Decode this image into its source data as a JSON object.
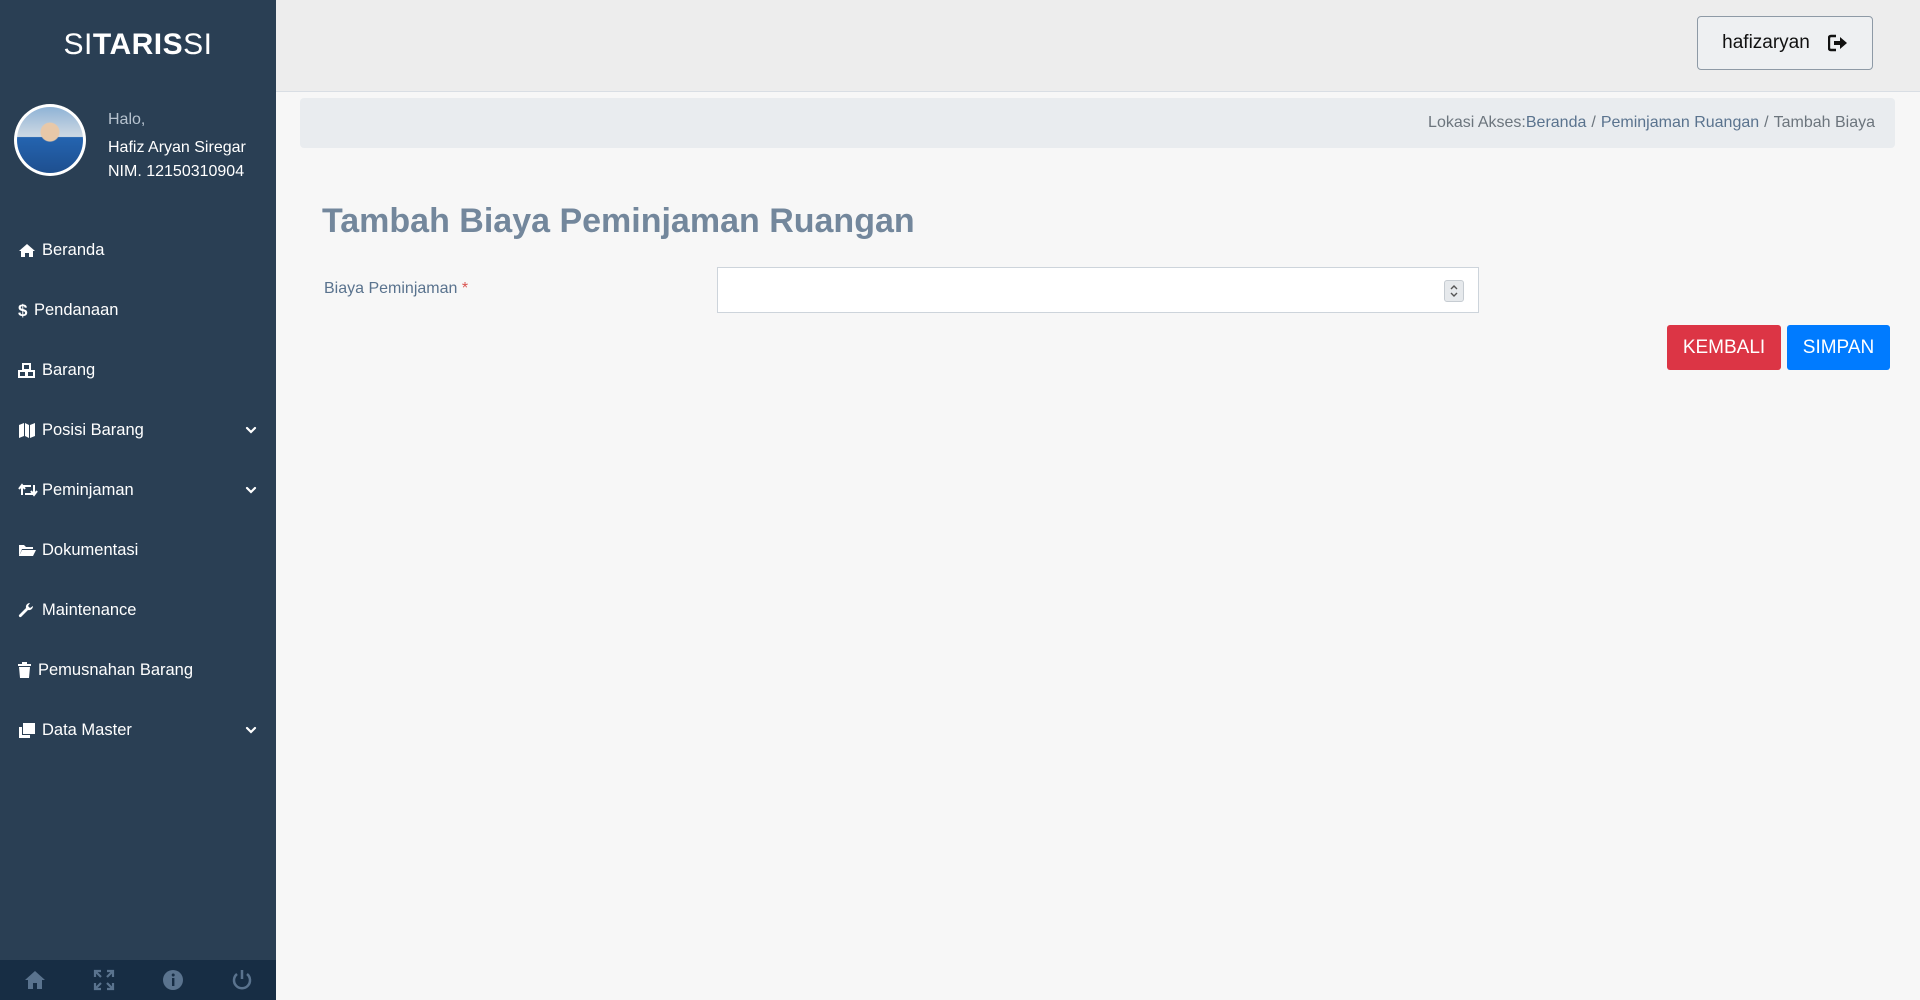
{
  "brand": {
    "part1": "SI",
    "bold": "TARIS",
    "part2": " SI"
  },
  "profile": {
    "greeting": "Halo,",
    "name": "Hafiz Aryan Siregar",
    "nim": "NIM. 12150310904"
  },
  "menu": [
    {
      "label": "Beranda",
      "icon": "home-icon",
      "has_chevron": false
    },
    {
      "label": "Pendanaan",
      "icon": "dollar-icon",
      "has_chevron": false
    },
    {
      "label": "Barang",
      "icon": "cubes-icon",
      "has_chevron": false
    },
    {
      "label": "Posisi Barang",
      "icon": "map-icon",
      "has_chevron": true
    },
    {
      "label": "Peminjaman",
      "icon": "retweet-icon",
      "has_chevron": true
    },
    {
      "label": "Dokumentasi",
      "icon": "folder-open-icon",
      "has_chevron": false
    },
    {
      "label": "Maintenance",
      "icon": "wrench-icon",
      "has_chevron": false
    },
    {
      "label": "Pemusnahan Barang",
      "icon": "trash-icon",
      "has_chevron": false
    },
    {
      "label": "Data Master",
      "icon": "clone-icon",
      "has_chevron": true
    }
  ],
  "footer_icons": [
    "home-icon",
    "fullscreen-icon",
    "info-icon",
    "power-icon"
  ],
  "topnav": {
    "username": "hafizaryan",
    "icon": "sign-out-icon"
  },
  "breadcrumb": {
    "prefix": "Lokasi Akses: ",
    "items": [
      "Beranda",
      "Peminjaman Ruangan",
      "Tambah Biaya"
    ],
    "separator": "/"
  },
  "page": {
    "title": "Tambah Biaya Peminjaman Ruangan"
  },
  "form": {
    "label": "Biaya Peminjaman",
    "required_mark": "*",
    "value": "",
    "placeholder": ""
  },
  "buttons": {
    "back": "KEMBALI",
    "save": "SIMPAN"
  },
  "colors": {
    "sidebar": "#2a3f54",
    "sidebar_footer": "#172d44",
    "title": "#73879c",
    "danger": "#dc3545",
    "primary": "#007bff"
  }
}
